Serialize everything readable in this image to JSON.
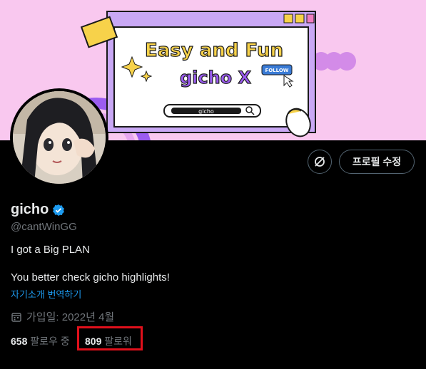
{
  "banner": {
    "headline": "Easy and Fun",
    "subline": "gicho X",
    "follow_badge": "FOLLOW",
    "search_text": "gicho",
    "bg_color": "#f9c8ef",
    "window_color": "#c9a8f5"
  },
  "profile": {
    "name": "gicho",
    "handle": "@cantWinGG",
    "bio_line1": "I got a Big PLAN",
    "bio_line2": "You better check gicho highlights!",
    "translate_link": "자기소개 번역하기",
    "joined": "가입일: 2022년 4월",
    "following_count": "658",
    "following_label": "팔로우 중",
    "followers_count": "809",
    "followers_label": "팔로워"
  },
  "actions": {
    "edit_profile": "프로필 수정",
    "icon": "link-slash-icon"
  },
  "colors": {
    "accent": "#1d9bf0",
    "highlight_box": "#e0101b"
  }
}
